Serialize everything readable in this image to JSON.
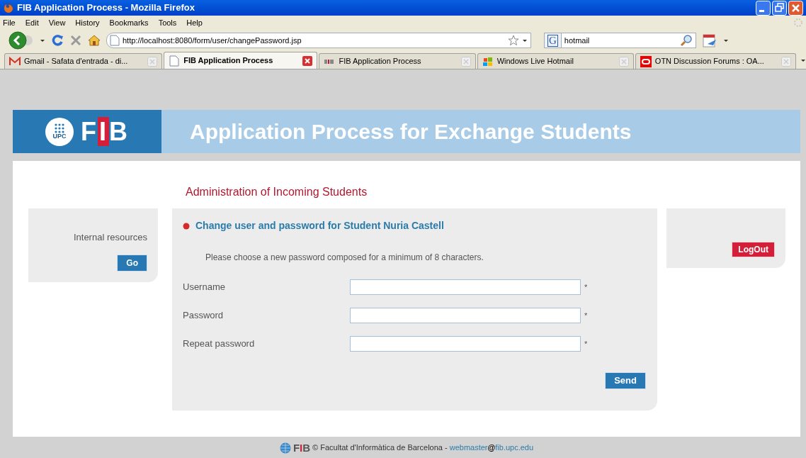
{
  "window": {
    "title": "FIB Application Process - Mozilla Firefox"
  },
  "menu": [
    "File",
    "Edit",
    "View",
    "History",
    "Bookmarks",
    "Tools",
    "Help"
  ],
  "navbar": {
    "url": "http://localhost:8080/form/user/changePassword.jsp",
    "search_value": "hotmail",
    "search_engine": "G"
  },
  "tabs": [
    {
      "label": "Gmail - Safata d'entrada - di...",
      "selected": false,
      "kind": "gmail"
    },
    {
      "label": "FIB Application Process",
      "selected": true,
      "kind": "page"
    },
    {
      "label": "FIB Application Process",
      "selected": false,
      "kind": "fib"
    },
    {
      "label": "Windows Live Hotmail",
      "selected": false,
      "kind": "windows"
    },
    {
      "label": "OTN Discussion Forums : OA...",
      "selected": false,
      "kind": "oracle"
    }
  ],
  "header": {
    "logo_badge": "UPC",
    "logo_letters": "FIB",
    "title": "Application Process for Exchange Students"
  },
  "section_title": "Administration of Incoming Students",
  "left_panel": {
    "label": "Internal resources",
    "button": "Go"
  },
  "form": {
    "title": "Change user and password for Student Nuria Castell",
    "instructions": "Please choose a new password composed for a minimum of 8 characters.",
    "fields": [
      {
        "label": "Username",
        "required_mark": "*"
      },
      {
        "label": "Password",
        "required_mark": "*"
      },
      {
        "label": "Repeat password",
        "required_mark": "*"
      }
    ],
    "submit": "Send"
  },
  "right_panel": {
    "button": "LogOut"
  },
  "footer": {
    "logo_letters": "FIB",
    "text": "© Facultat d'Informàtica de Barcelona - ",
    "link_user": "webmaster",
    "at": "@",
    "link_domain": "fib.upc.edu"
  }
}
